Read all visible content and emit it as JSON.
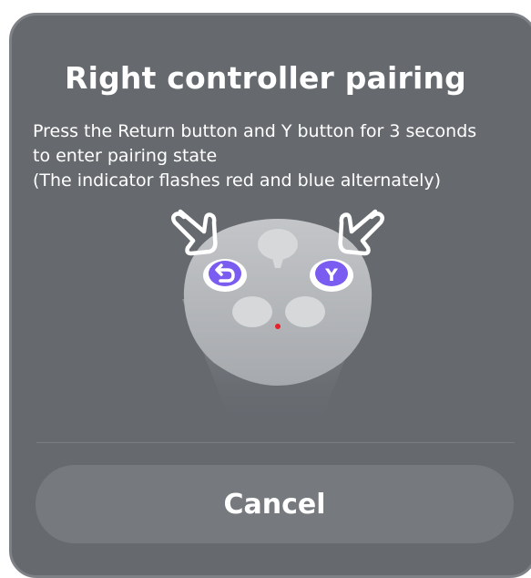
{
  "dialog": {
    "title": "Right controller pairing",
    "description": {
      "line1": "Press the Return button and Y button for 3 seconds",
      "line2": "to enter pairing state",
      "line3": "(The indicator flashes red and blue alternately)"
    },
    "illustration": {
      "return_icon": "return-arrow-icon",
      "y_button_label": "Y",
      "indicator_color": "#e8202a",
      "button_color": "#7b5cf0"
    },
    "cancel_label": "Cancel"
  }
}
